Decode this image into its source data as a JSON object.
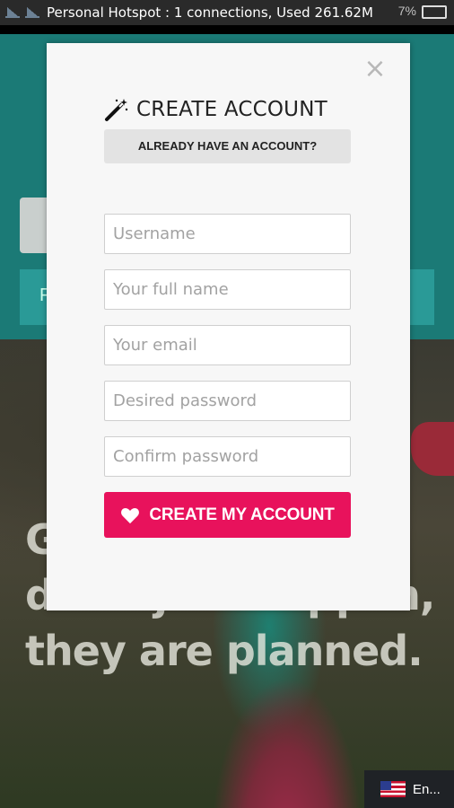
{
  "status_bar": {
    "text": "Personal Hotspot : 1 connections, Used 261.62M",
    "battery_pct": "7%"
  },
  "background": {
    "hero_text": "Great weddings don't just happen, they are planned.",
    "left_bar_letter": "F"
  },
  "modal": {
    "title": "CREATE ACCOUNT",
    "have_account_label": "ALREADY HAVE AN ACCOUNT?",
    "close_label": "×",
    "fields": [
      {
        "placeholder": "Username",
        "value": ""
      },
      {
        "placeholder": "Your full name",
        "value": ""
      },
      {
        "placeholder": "Your email",
        "value": ""
      },
      {
        "placeholder": "Desired password",
        "value": ""
      },
      {
        "placeholder": "Confirm password",
        "value": ""
      }
    ],
    "submit_label": "CREATE MY ACCOUNT"
  },
  "language": {
    "label": "En..."
  },
  "colors": {
    "header_teal": "#1b7a76",
    "submit_pink": "#e8125c",
    "modal_bg": "#f7f7f7"
  },
  "icons": [
    "magic-wand-icon",
    "heart-icon",
    "close-icon",
    "us-flag-icon"
  ]
}
